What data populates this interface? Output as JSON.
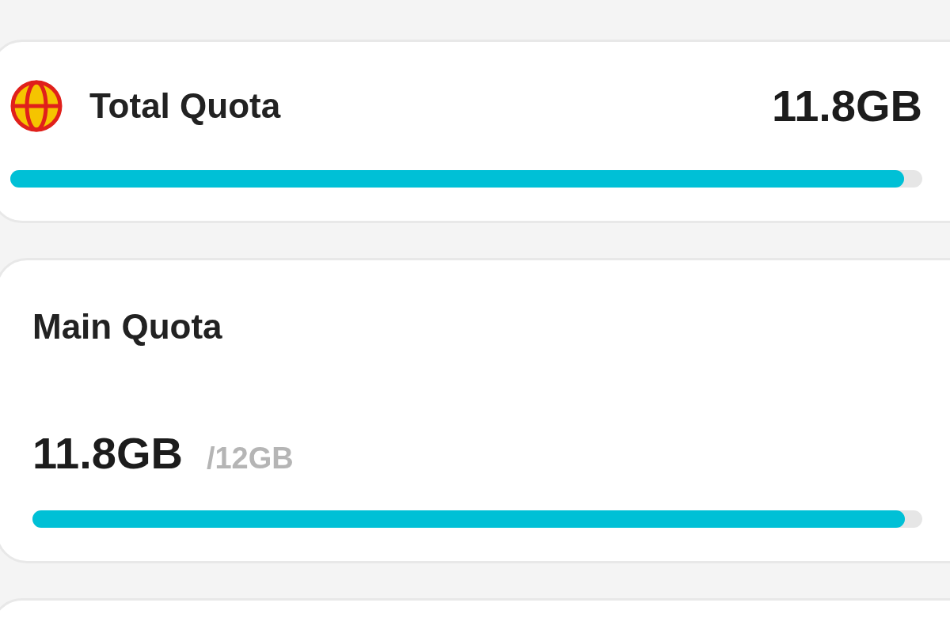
{
  "total_quota": {
    "title": "Total Quota",
    "used": "11.8GB",
    "level": 0.98
  },
  "main_quota": {
    "title": "Main Quota",
    "used": "11.8GB",
    "limit": "/12GB",
    "level": 0.98
  }
}
